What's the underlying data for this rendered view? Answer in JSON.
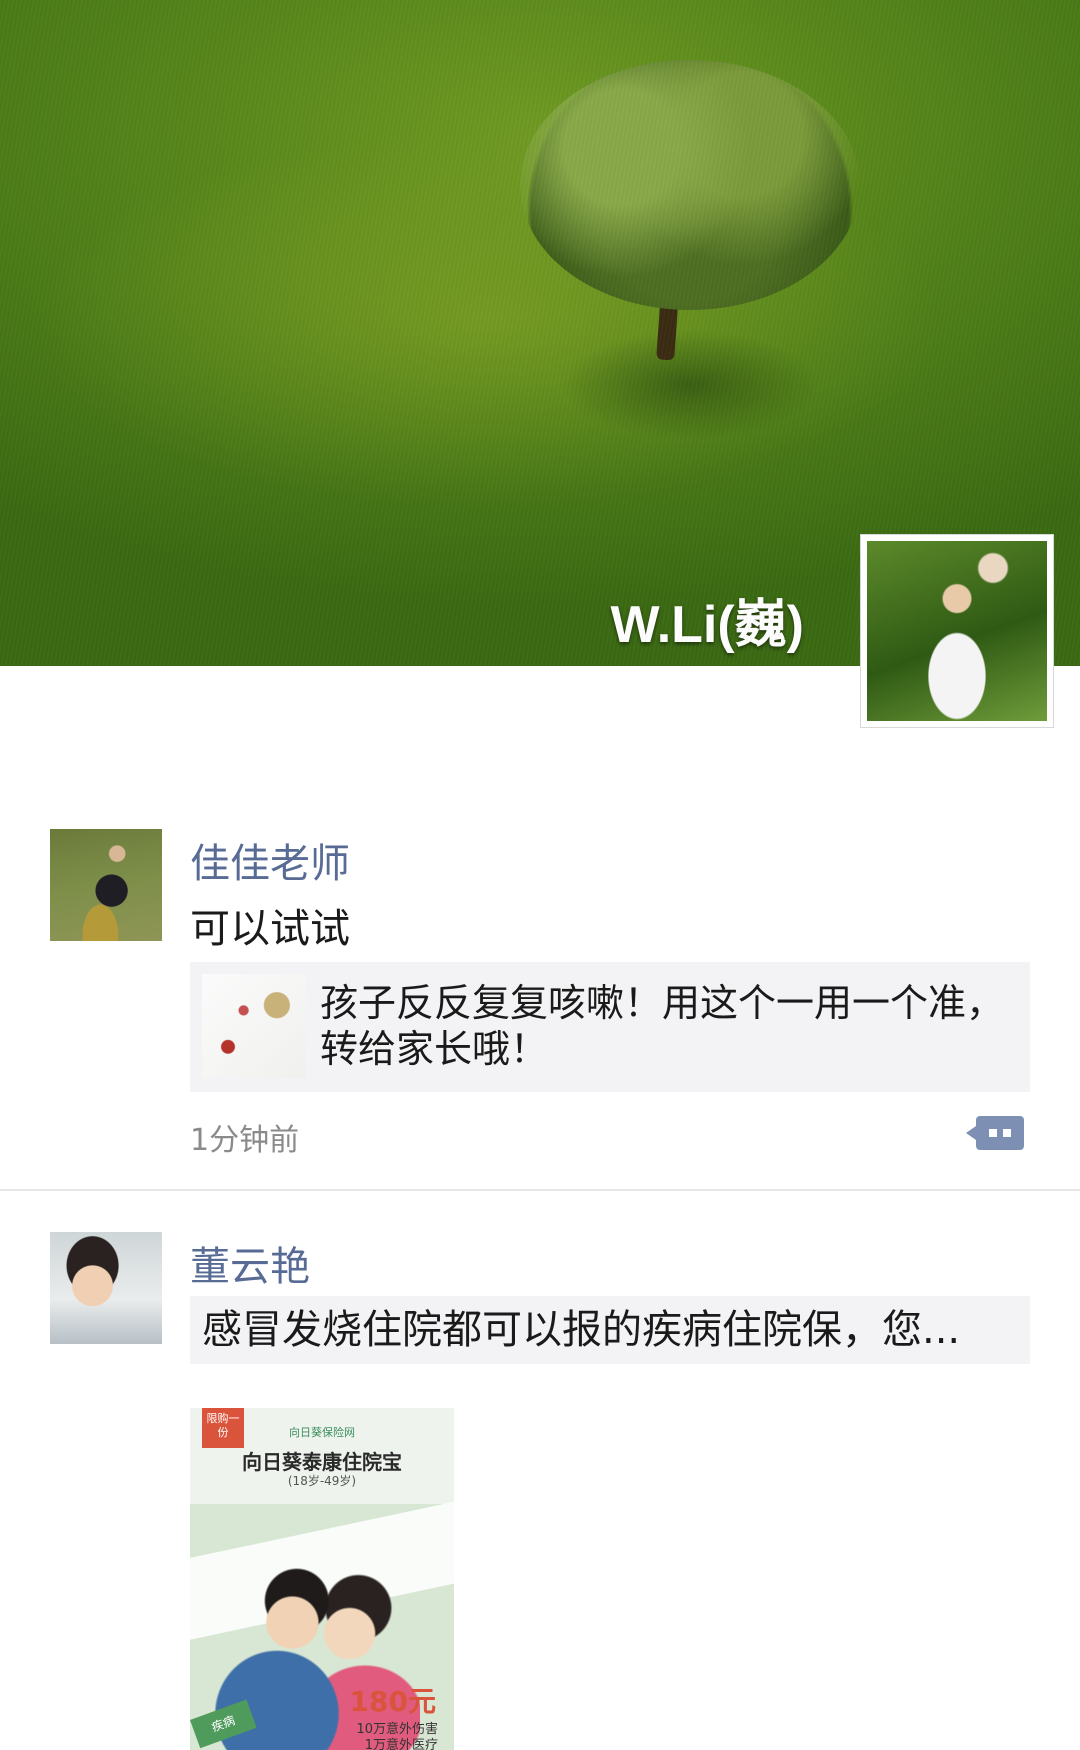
{
  "profile": {
    "display_name": "W.Li(巍)"
  },
  "posts": [
    {
      "author": "佳佳老师",
      "text": "可以试试",
      "link_title": "孩子反反复复咳嗽！用这个一用一个准，转给家长哦！",
      "time": "1分钟前"
    },
    {
      "author": "董云艳",
      "share_title": "感冒发烧住院都可以报的疾病住院保，您...",
      "ad": {
        "badge": "限购一份",
        "brand": "向日葵保险网",
        "title": "向日葵泰康住院宝",
        "age_range": "(18岁-49岁)",
        "price": "180元",
        "line1": "10万意外伤害",
        "line2": "1万意外医疗",
        "corner": "疾病"
      }
    }
  ],
  "colors": {
    "name_link": "#576b95",
    "comment_button": "#7d8fb3"
  },
  "icons": {
    "comment": "comment-icon"
  }
}
